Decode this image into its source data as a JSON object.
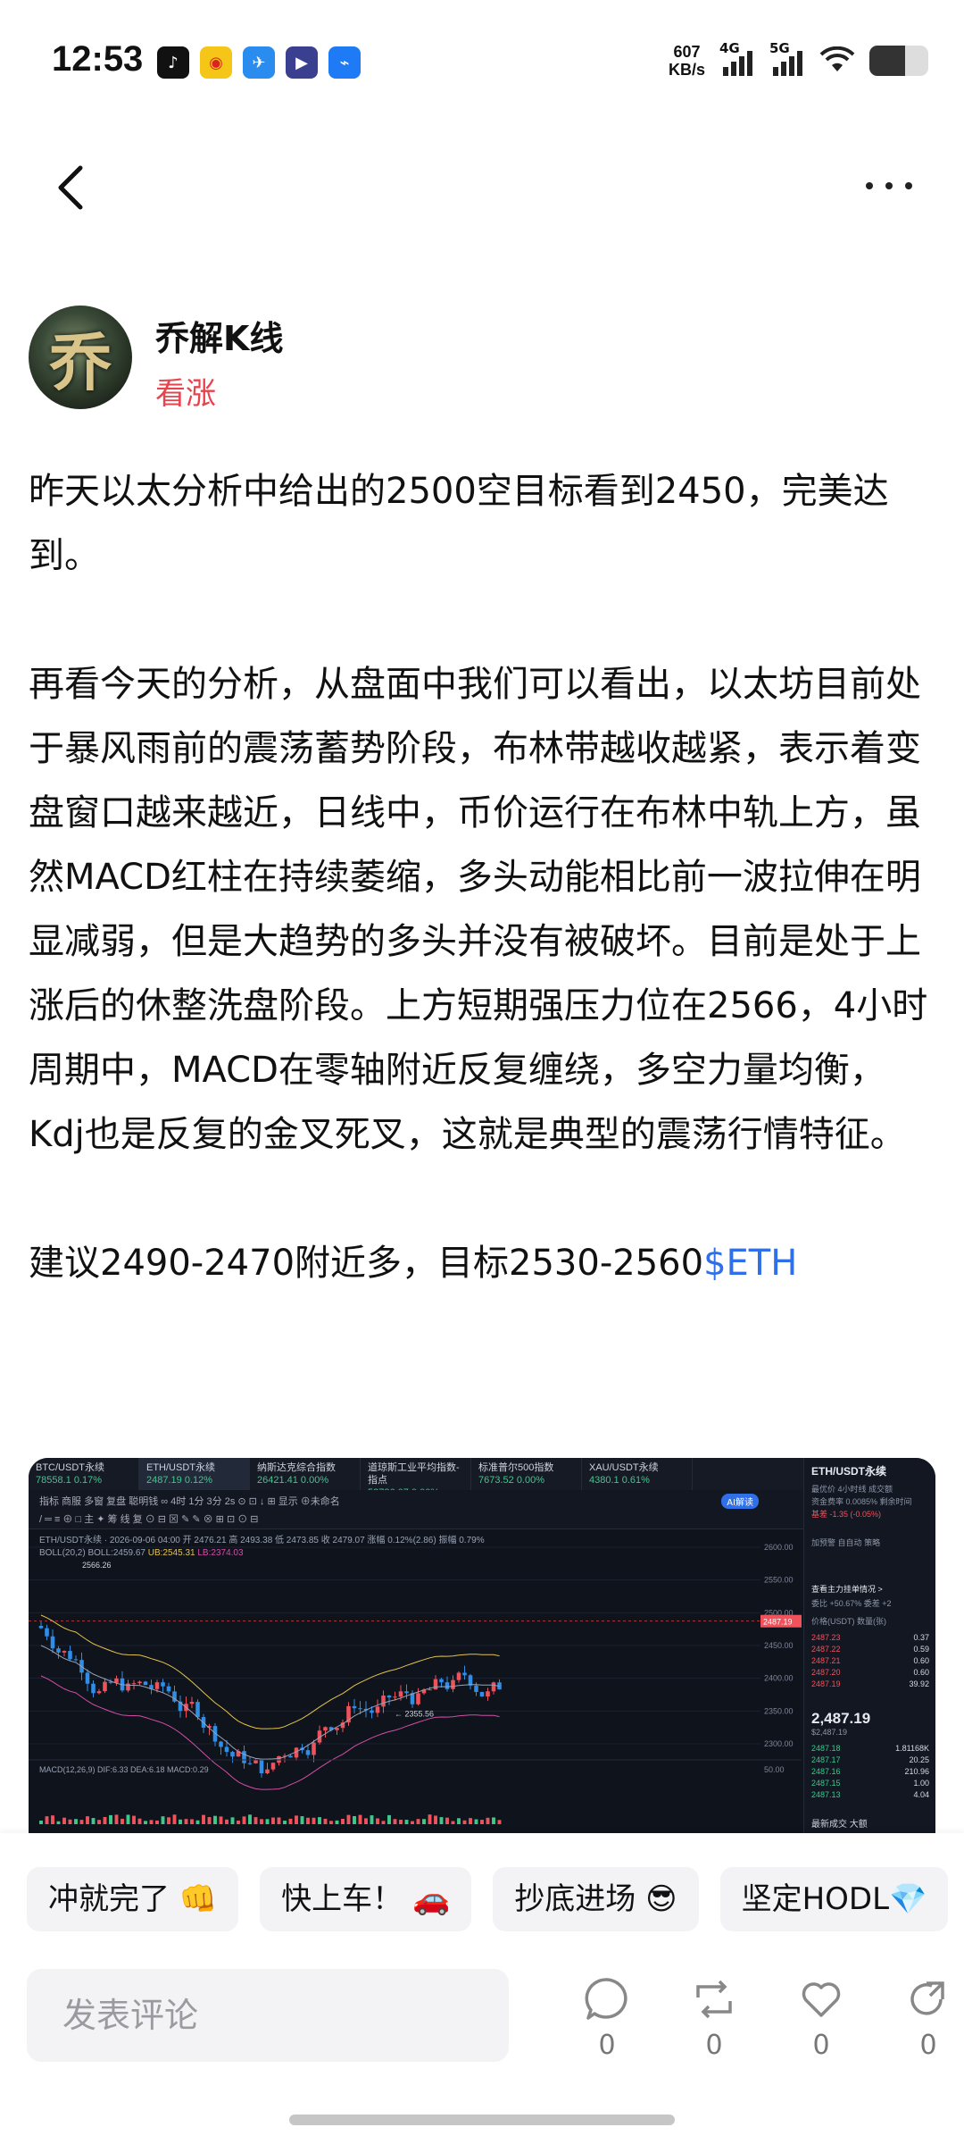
{
  "status_bar": {
    "time": "12:53",
    "app_icons": [
      "tiktok-icon",
      "weibo-icon",
      "feishu-icon",
      "video-icon",
      "lark-icon"
    ],
    "net_speed_value": "607",
    "net_speed_unit": "KB/s",
    "signal_1": "4G",
    "signal_2": "5G",
    "battery_level": 0.6
  },
  "nav": {
    "back_icon": "chevron-left-icon",
    "more_icon": "more-dots-icon"
  },
  "author": {
    "avatar_glyph": "乔",
    "name": "乔解K线",
    "sentiment": "看涨"
  },
  "post": {
    "para1": "昨天以太分析中给出的2500空目标看到2450，完美达到。",
    "para2": "再看今天的分析，从盘面中我们可以看出，以太坊目前处于暴风雨前的震荡蓄势阶段，布林带越收越紧，表示着变盘窗口越来越近，日线中，币价运行在布林中轨上方，虽然MACD红柱在持续萎缩，多头动能相比前一波拉伸在明显减弱，但是大趋势的多头并没有被破坏。目前是处于上涨后的休整洗盘阶段。上方短期强压力位在2566，4小时周期中，MACD在零轴附近反复缠绕，多空力量均衡，Kdj也是反复的金叉死叉，这就是典型的震荡行情特征。",
    "para3": "建议2490-2470附近多，目标2530-2560",
    "ticker": "$ETH"
  },
  "chart_image": {
    "tabs": [
      {
        "name": "BTC/USDT永续",
        "value": "78558.1 0.17%"
      },
      {
        "name": "ETH/USDT永续",
        "value": "2487.19 0.12%"
      },
      {
        "name": "纳斯达克综合指数",
        "value": "26421.41 0.00%"
      },
      {
        "name": "道琼斯工业平均指数-指点",
        "value": "52786.07 0.00%"
      },
      {
        "name": "标准普尔500指数",
        "value": "7673.52 0.00%"
      },
      {
        "name": "XAU/USDT永续",
        "value": "4380.1 0.61%"
      }
    ],
    "toolbar_row1": "指标   商服   多窗   复盘   聪明钱   ∞   4时   1分   3分        2s   ⊙   ⊡   ↓   ⊞   显示   ⊕未命名",
    "toolbar_row2": "/  ═  ≡  ⊕  □    主  ✦  筹  线  复  ⊙  ⊟  ⊠  ✎  ✎  ⊗  ⊞  ⊡  ⊙  ⊟",
    "ai_label": "AI解读",
    "info_line1": "ETH/USDT永续 · 2026-09-06 04:00  开 2476.21  高 2493.38  低 2473.85  收 2479.07  涨幅 0.12%(2.86)  振幅 0.79%",
    "info_line2": "BOLL(20,2)  BOLL:2459.67",
    "info_ub": "UB:2545.31",
    "info_lb": "LB:2374.03",
    "macd_label": "MACD(12,26,9)  DIF:6.33  DEA:6.18  MACD:0.29",
    "high_label": "2566.26",
    "low_label": "← 2355.56",
    "price_tag": "2487.19",
    "y_ticks": [
      "2600.00",
      "2550.00",
      "2500.00",
      "2450.00",
      "2400.00",
      "2350.00",
      "2300.00"
    ],
    "macd_tick": "50.00",
    "orderbook": {
      "title": "ETH/USDT永续",
      "line1": "最优价  4小时线    成交额",
      "line2": "资金费率 0.0085%  剩余时间",
      "line3": "基差  -1.35 (-0.05%)",
      "btn1": "加预警",
      "btn2": "自自动",
      "btn3": "策略",
      "depth_title": "查看主力挂单情况 >",
      "ratio": "委比  +50.67%   委差 +2",
      "header": "价格(USDT)    数量(张)",
      "asks": [
        {
          "p": "2487.23",
          "q": "0.37"
        },
        {
          "p": "2487.22",
          "q": "0.59"
        },
        {
          "p": "2487.21",
          "q": "0.60"
        },
        {
          "p": "2487.20",
          "q": "0.60"
        },
        {
          "p": "2487.19",
          "q": "39.92"
        }
      ],
      "last_price": "2,487.19",
      "last_sub": "$2,487.19",
      "bids": [
        {
          "p": "2487.18",
          "q": "1.81168K"
        },
        {
          "p": "2487.17",
          "q": "20.25"
        },
        {
          "p": "2487.16",
          "q": "210.96"
        },
        {
          "p": "2487.15",
          "q": "1.00"
        },
        {
          "p": "2487.13",
          "q": "4.04"
        }
      ],
      "bottom": "最新成交    大额"
    }
  },
  "quick_replies": [
    "冲就完了 👊",
    "快上车！ 🚗",
    "抄底进场 😎",
    "坚定HODL💎"
  ],
  "comment": {
    "placeholder": "发表评论"
  },
  "actions": [
    {
      "icon": "comment-icon",
      "count": "0"
    },
    {
      "icon": "repost-icon",
      "count": "0"
    },
    {
      "icon": "like-heart-icon",
      "count": "0"
    },
    {
      "icon": "share-icon",
      "count": "0"
    }
  ],
  "colors": {
    "accent_blue": "#2f6fe8",
    "bullish_red": "#e8434c",
    "candle_up": "#f0525c",
    "candle_down": "#2f8fe8",
    "chart_bg": "#0f131c"
  }
}
